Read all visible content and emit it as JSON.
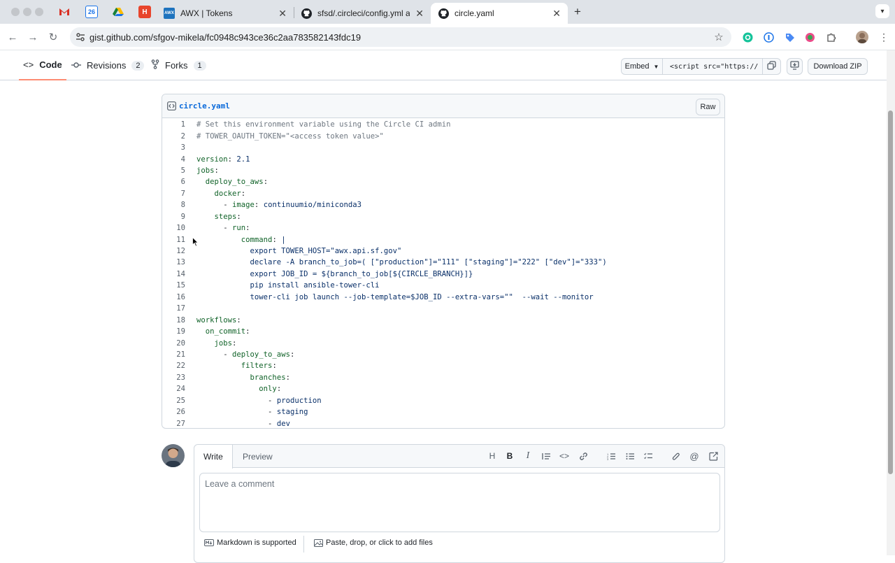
{
  "browser": {
    "tabs": [
      {
        "title": "AWX | Tokens",
        "favicon": "awx-icon"
      },
      {
        "title": "sfsd/.circleci/config.yml at m",
        "favicon": "github-icon"
      },
      {
        "title": "circle.yaml",
        "favicon": "github-icon"
      }
    ],
    "pinned": [
      "gmail-icon",
      "calendar-icon",
      "drive-icon",
      "harvest-icon"
    ],
    "calendar_day": "26",
    "new_tab": "+",
    "url": "gist.github.com/sfgov-mikela/fc0948c943ce36c2aa783582143fdc19"
  },
  "gist": {
    "tabs": [
      {
        "label": "Code"
      },
      {
        "label": "Revisions",
        "count": "2"
      },
      {
        "label": "Forks",
        "count": "1"
      }
    ],
    "embed_label": "Embed",
    "embed_code": "<script src=\"https://",
    "download_label": "Download ZIP"
  },
  "file": {
    "name": "circle.yaml",
    "raw_label": "Raw",
    "lines": [
      "# Set this environment variable using the Circle CI admin",
      "# TOWER_OAUTH_TOKEN=\"<access token value>\"",
      "",
      "version: 2.1",
      "jobs:",
      "  deploy_to_aws:",
      "    docker:",
      "      - image: continuumio/miniconda3",
      "    steps:",
      "      - run:",
      "          command: |",
      "            export TOWER_HOST=\"awx.api.sf.gov\"",
      "            declare -A branch_to_job=( [\"production\"]=\"111\" [\"staging\"]=\"222\" [\"dev\"]=\"333\")",
      "            export JOB_ID = ${branch_to_job[${CIRCLE_BRANCH}]}",
      "            pip install ansible-tower-cli",
      "            tower-cli job launch --job-template=$JOB_ID --extra-vars=\"\"  --wait --monitor",
      "",
      "workflows:",
      "  on_commit:",
      "    jobs:",
      "      - deploy_to_aws:",
      "          filters:",
      "            branches:",
      "              only:",
      "                - production",
      "                - staging",
      "                - dev"
    ]
  },
  "comment": {
    "write_tab": "Write",
    "preview_tab": "Preview",
    "placeholder": "Leave a comment",
    "markdown_note": "Markdown is supported",
    "attach_note": "Paste, drop, or click to add files"
  }
}
